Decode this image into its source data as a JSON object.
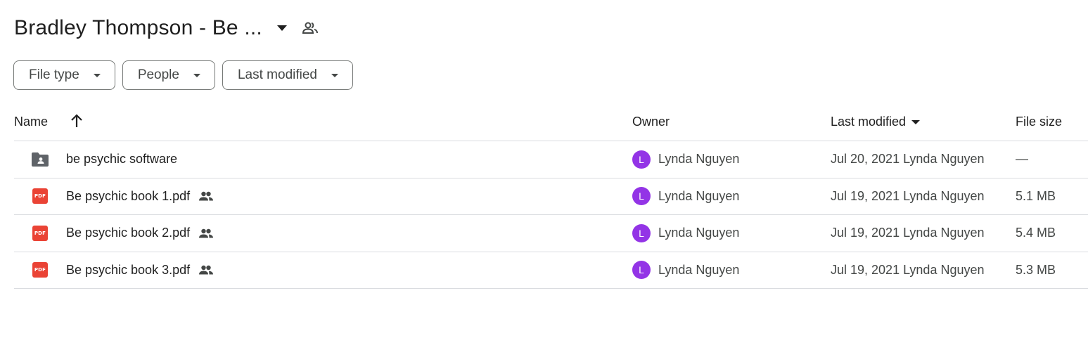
{
  "header": {
    "title": "Bradley Thompson - Be ...",
    "caret_icon": "arrow-drop-down-icon",
    "shared_icon": "shared-people-icon"
  },
  "filters": [
    {
      "label": "File type"
    },
    {
      "label": "People"
    },
    {
      "label": "Last modified"
    }
  ],
  "columns": {
    "name": "Name",
    "owner": "Owner",
    "last_modified": "Last modified",
    "file_size": "File size"
  },
  "rows": [
    {
      "icon": "shared-folder-icon",
      "name": "be psychic software",
      "shared": false,
      "owner_initial": "L",
      "owner": "Lynda Nguyen",
      "modified": "Jul 20, 2021 Lynda Nguyen",
      "size": "—"
    },
    {
      "icon": "pdf-icon",
      "icon_text": "PDF",
      "name": "Be psychic book 1.pdf",
      "shared": true,
      "owner_initial": "L",
      "owner": "Lynda Nguyen",
      "modified": "Jul 19, 2021 Lynda Nguyen",
      "size": "5.1 MB"
    },
    {
      "icon": "pdf-icon",
      "icon_text": "PDF",
      "name": "Be psychic book 2.pdf",
      "shared": true,
      "owner_initial": "L",
      "owner": "Lynda Nguyen",
      "modified": "Jul 19, 2021 Lynda Nguyen",
      "size": "5.4 MB"
    },
    {
      "icon": "pdf-icon",
      "icon_text": "PDF",
      "name": "Be psychic book 3.pdf",
      "shared": true,
      "owner_initial": "L",
      "owner": "Lynda Nguyen",
      "modified": "Jul 19, 2021 Lynda Nguyen",
      "size": "5.3 MB"
    }
  ],
  "colors": {
    "avatar": "#9334e6",
    "pdf": "#ea4335",
    "folder": "#5f6368",
    "divider": "#dadce0"
  }
}
